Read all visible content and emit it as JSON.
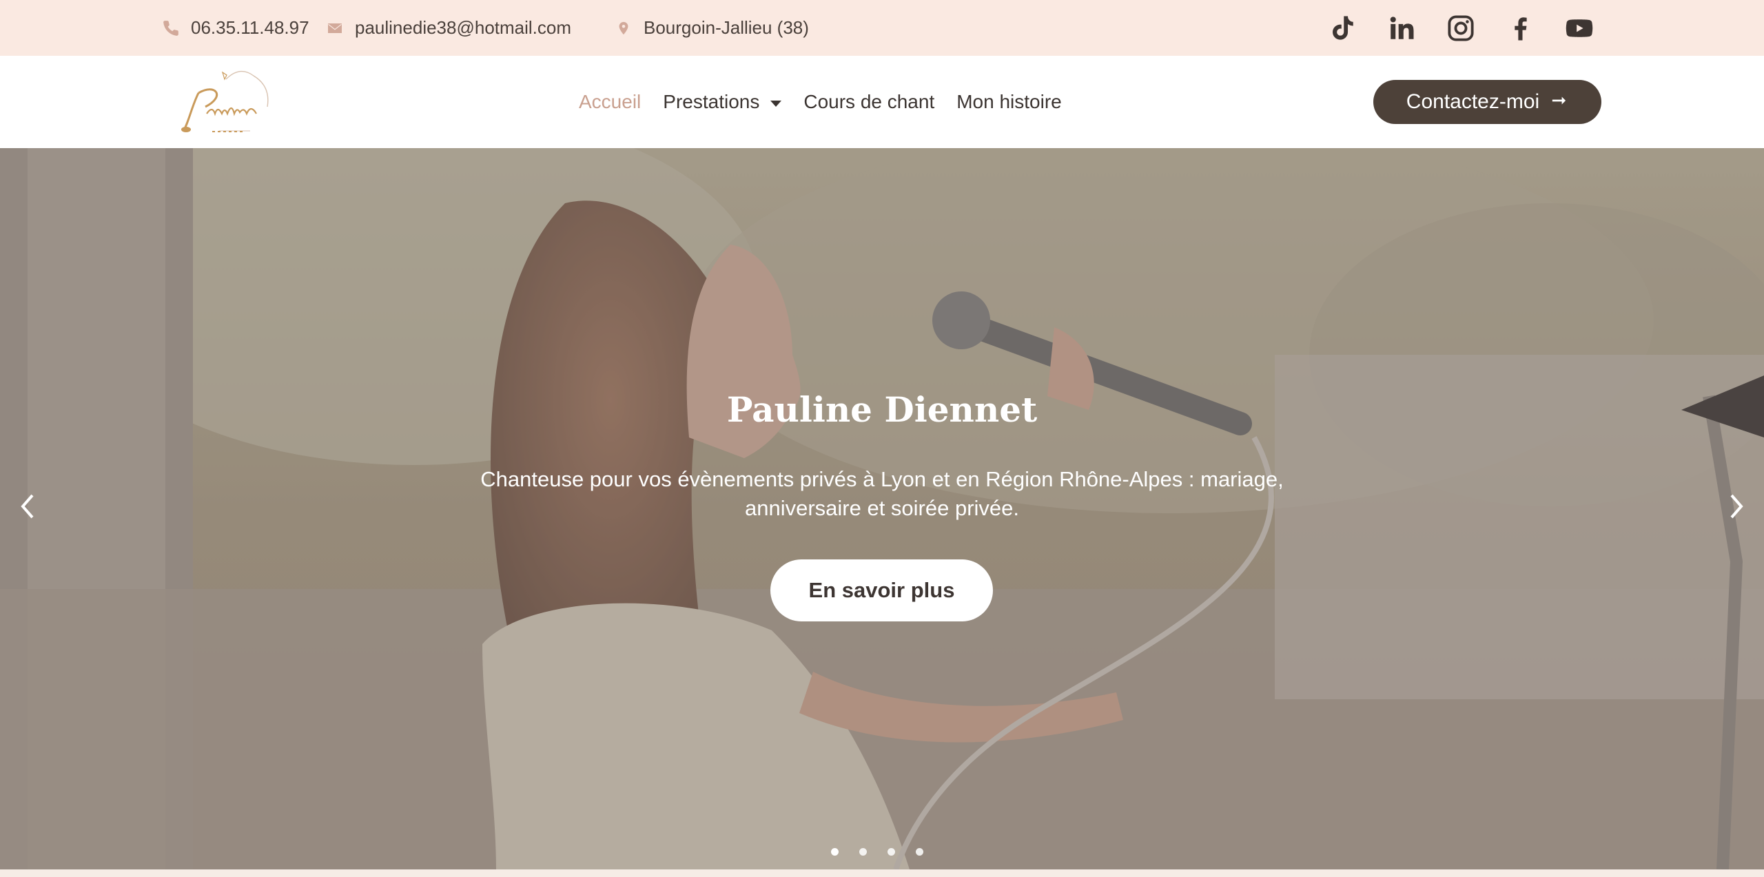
{
  "topbar": {
    "phone": "06.35.11.48.97",
    "email": "paulinedie38@hotmail.com",
    "location": "Bourgoin-Jallieu (38)",
    "icons": [
      "phone-icon",
      "envelope-icon",
      "map-pin-icon"
    ],
    "socials": [
      "tiktok-icon",
      "linkedin-icon",
      "instagram-icon",
      "facebook-icon",
      "youtube-icon"
    ]
  },
  "header": {
    "logo_alt": "Pauline Diennet",
    "nav": [
      {
        "label": "Accueil",
        "active": true
      },
      {
        "label": "Prestations",
        "dropdown": true
      },
      {
        "label": "Cours de chant"
      },
      {
        "label": "Mon histoire"
      }
    ],
    "cta_label": "Contactez-moi",
    "cta_icon": "arrow-right-icon"
  },
  "hero": {
    "title": "Pauline Diennet",
    "subtitle": "Chanteuse pour vos évènements privés à Lyon et en Région Rhône-Alpes : mariage, anniversaire et soirée privée.",
    "button_label": "En savoir plus",
    "prev_icon": "chevron-left-icon",
    "next_icon": "chevron-right-icon",
    "slide_count": 4,
    "active_slide": 1
  },
  "colors": {
    "topbar_bg": "#fae9e1",
    "accent": "#c9a08f",
    "cta_bg": "#4d4139",
    "text": "#3b3431"
  }
}
